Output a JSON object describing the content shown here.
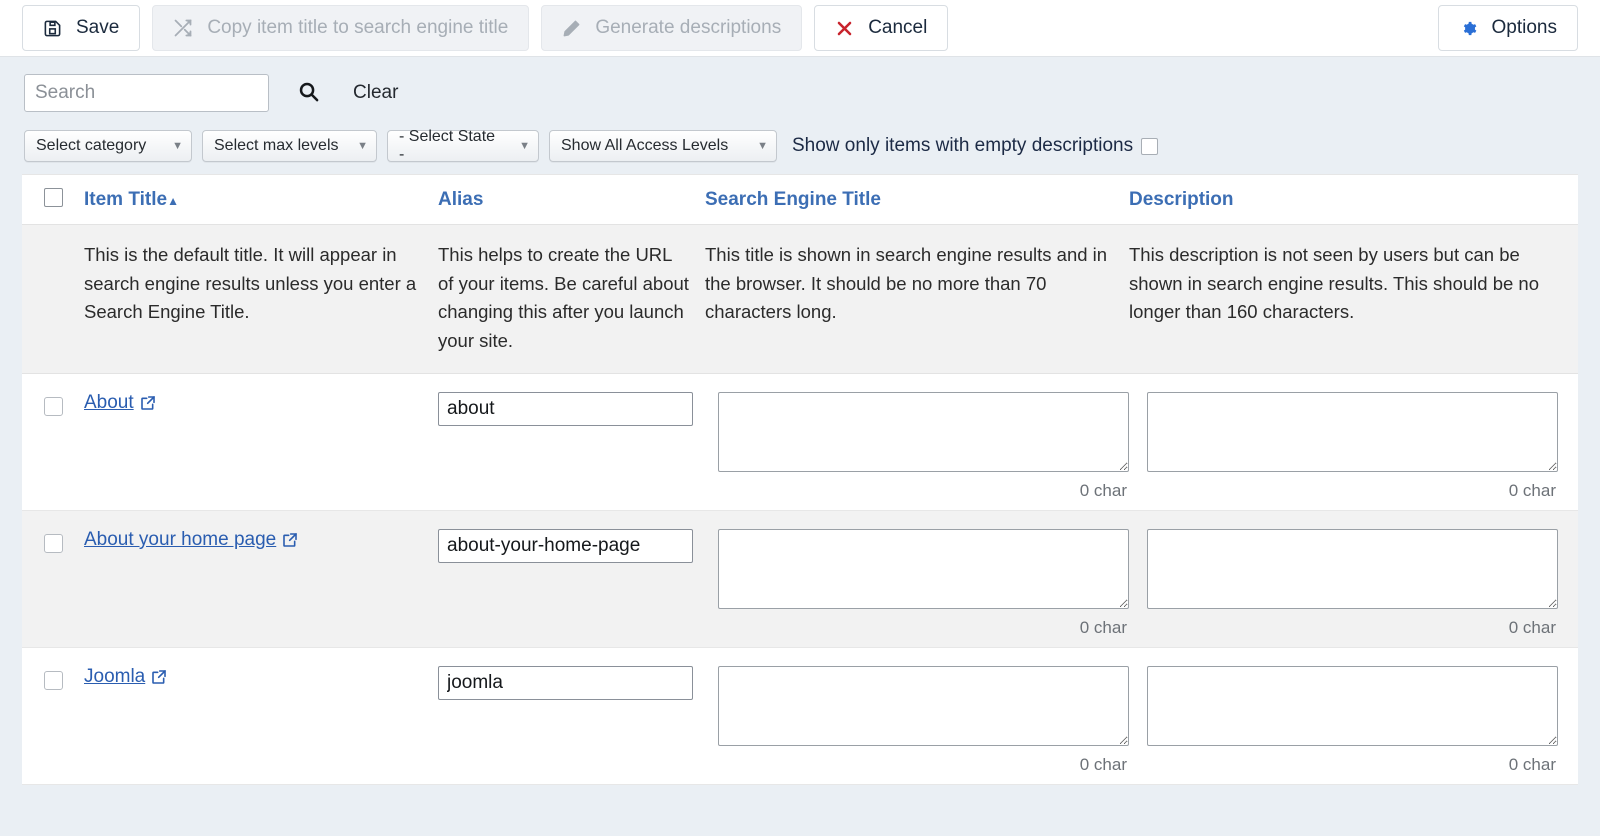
{
  "toolbar": {
    "buttons": [
      {
        "label": "Save",
        "icon": "save-icon",
        "disabled": false
      },
      {
        "label": "Copy item title to search engine title",
        "icon": "shuffle-icon",
        "disabled": true
      },
      {
        "label": "Generate descriptions",
        "icon": "pencil-icon",
        "disabled": true
      },
      {
        "label": "Cancel",
        "icon": "x-icon",
        "disabled": false
      }
    ],
    "options_label": "Options",
    "options_icon": "gear-icon"
  },
  "filters": {
    "search_placeholder": "Search",
    "search_value": "",
    "search_icon": "search-icon",
    "clear_label": "Clear",
    "selects": [
      {
        "label": "Select category"
      },
      {
        "label": "Select max levels"
      },
      {
        "label": "- Select State -"
      },
      {
        "label": "Show All Access Levels"
      }
    ],
    "empty_desc_label": "Show only items with empty descriptions",
    "empty_desc_checked": false
  },
  "table": {
    "headers": {
      "select_all": "",
      "item_title": "Item Title",
      "sort_caret": "▲",
      "alias": "Alias",
      "search_engine_title": "Search Engine Title",
      "description": "Description"
    },
    "help": {
      "item_title": "This is the default title. It will appear in search engine results unless you enter a Search Engine Title.",
      "alias": "This helps to create the URL of your items. Be careful about changing this after you launch your site.",
      "search_engine_title": "This title is shown in search engine results and in the browser. It should be no more than 70 characters long.",
      "description": "This description is not seen by users but can be shown in search engine results. This should be no longer than 160 characters."
    },
    "rows": [
      {
        "title": "About",
        "link_icon": "external-link-icon",
        "alias": "about",
        "search_engine_title": "",
        "description": "",
        "set_char_count": "0 char",
        "desc_char_count": "0 char"
      },
      {
        "title": "About your home page",
        "link_icon": "external-link-icon",
        "alias": "about-your-home-page",
        "search_engine_title": "",
        "description": "",
        "set_char_count": "0 char",
        "desc_char_count": "0 char"
      },
      {
        "title": "Joomla",
        "link_icon": "external-link-icon",
        "alias": "joomla",
        "search_engine_title": "",
        "description": "",
        "set_char_count": "0 char",
        "desc_char_count": "0 char"
      }
    ]
  },
  "colors": {
    "link_blue": "#2a5db0",
    "header_blue": "#3c6eb4",
    "cancel_red": "#c8232c",
    "gear_blue": "#2a6fd6",
    "page_bg": "#eaeff4"
  }
}
